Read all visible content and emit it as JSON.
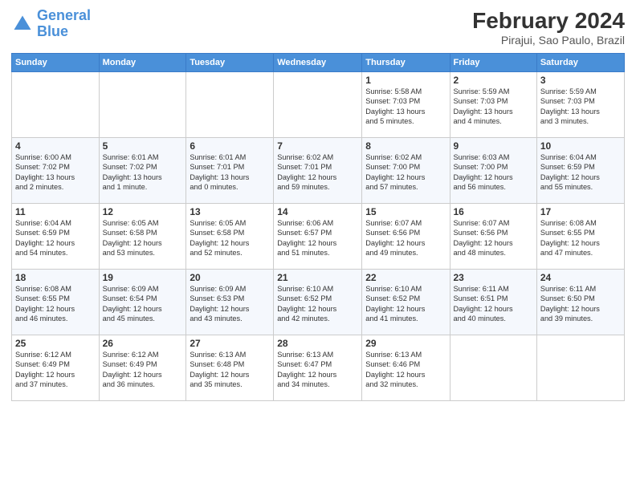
{
  "header": {
    "logo_line1": "General",
    "logo_line2": "Blue",
    "month_year": "February 2024",
    "location": "Pirajui, Sao Paulo, Brazil"
  },
  "weekdays": [
    "Sunday",
    "Monday",
    "Tuesday",
    "Wednesday",
    "Thursday",
    "Friday",
    "Saturday"
  ],
  "weeks": [
    [
      {
        "day": "",
        "info": ""
      },
      {
        "day": "",
        "info": ""
      },
      {
        "day": "",
        "info": ""
      },
      {
        "day": "",
        "info": ""
      },
      {
        "day": "1",
        "info": "Sunrise: 5:58 AM\nSunset: 7:03 PM\nDaylight: 13 hours\nand 5 minutes."
      },
      {
        "day": "2",
        "info": "Sunrise: 5:59 AM\nSunset: 7:03 PM\nDaylight: 13 hours\nand 4 minutes."
      },
      {
        "day": "3",
        "info": "Sunrise: 5:59 AM\nSunset: 7:03 PM\nDaylight: 13 hours\nand 3 minutes."
      }
    ],
    [
      {
        "day": "4",
        "info": "Sunrise: 6:00 AM\nSunset: 7:02 PM\nDaylight: 13 hours\nand 2 minutes."
      },
      {
        "day": "5",
        "info": "Sunrise: 6:01 AM\nSunset: 7:02 PM\nDaylight: 13 hours\nand 1 minute."
      },
      {
        "day": "6",
        "info": "Sunrise: 6:01 AM\nSunset: 7:01 PM\nDaylight: 13 hours\nand 0 minutes."
      },
      {
        "day": "7",
        "info": "Sunrise: 6:02 AM\nSunset: 7:01 PM\nDaylight: 12 hours\nand 59 minutes."
      },
      {
        "day": "8",
        "info": "Sunrise: 6:02 AM\nSunset: 7:00 PM\nDaylight: 12 hours\nand 57 minutes."
      },
      {
        "day": "9",
        "info": "Sunrise: 6:03 AM\nSunset: 7:00 PM\nDaylight: 12 hours\nand 56 minutes."
      },
      {
        "day": "10",
        "info": "Sunrise: 6:04 AM\nSunset: 6:59 PM\nDaylight: 12 hours\nand 55 minutes."
      }
    ],
    [
      {
        "day": "11",
        "info": "Sunrise: 6:04 AM\nSunset: 6:59 PM\nDaylight: 12 hours\nand 54 minutes."
      },
      {
        "day": "12",
        "info": "Sunrise: 6:05 AM\nSunset: 6:58 PM\nDaylight: 12 hours\nand 53 minutes."
      },
      {
        "day": "13",
        "info": "Sunrise: 6:05 AM\nSunset: 6:58 PM\nDaylight: 12 hours\nand 52 minutes."
      },
      {
        "day": "14",
        "info": "Sunrise: 6:06 AM\nSunset: 6:57 PM\nDaylight: 12 hours\nand 51 minutes."
      },
      {
        "day": "15",
        "info": "Sunrise: 6:07 AM\nSunset: 6:56 PM\nDaylight: 12 hours\nand 49 minutes."
      },
      {
        "day": "16",
        "info": "Sunrise: 6:07 AM\nSunset: 6:56 PM\nDaylight: 12 hours\nand 48 minutes."
      },
      {
        "day": "17",
        "info": "Sunrise: 6:08 AM\nSunset: 6:55 PM\nDaylight: 12 hours\nand 47 minutes."
      }
    ],
    [
      {
        "day": "18",
        "info": "Sunrise: 6:08 AM\nSunset: 6:55 PM\nDaylight: 12 hours\nand 46 minutes."
      },
      {
        "day": "19",
        "info": "Sunrise: 6:09 AM\nSunset: 6:54 PM\nDaylight: 12 hours\nand 45 minutes."
      },
      {
        "day": "20",
        "info": "Sunrise: 6:09 AM\nSunset: 6:53 PM\nDaylight: 12 hours\nand 43 minutes."
      },
      {
        "day": "21",
        "info": "Sunrise: 6:10 AM\nSunset: 6:52 PM\nDaylight: 12 hours\nand 42 minutes."
      },
      {
        "day": "22",
        "info": "Sunrise: 6:10 AM\nSunset: 6:52 PM\nDaylight: 12 hours\nand 41 minutes."
      },
      {
        "day": "23",
        "info": "Sunrise: 6:11 AM\nSunset: 6:51 PM\nDaylight: 12 hours\nand 40 minutes."
      },
      {
        "day": "24",
        "info": "Sunrise: 6:11 AM\nSunset: 6:50 PM\nDaylight: 12 hours\nand 39 minutes."
      }
    ],
    [
      {
        "day": "25",
        "info": "Sunrise: 6:12 AM\nSunset: 6:49 PM\nDaylight: 12 hours\nand 37 minutes."
      },
      {
        "day": "26",
        "info": "Sunrise: 6:12 AM\nSunset: 6:49 PM\nDaylight: 12 hours\nand 36 minutes."
      },
      {
        "day": "27",
        "info": "Sunrise: 6:13 AM\nSunset: 6:48 PM\nDaylight: 12 hours\nand 35 minutes."
      },
      {
        "day": "28",
        "info": "Sunrise: 6:13 AM\nSunset: 6:47 PM\nDaylight: 12 hours\nand 34 minutes."
      },
      {
        "day": "29",
        "info": "Sunrise: 6:13 AM\nSunset: 6:46 PM\nDaylight: 12 hours\nand 32 minutes."
      },
      {
        "day": "",
        "info": ""
      },
      {
        "day": "",
        "info": ""
      }
    ]
  ]
}
